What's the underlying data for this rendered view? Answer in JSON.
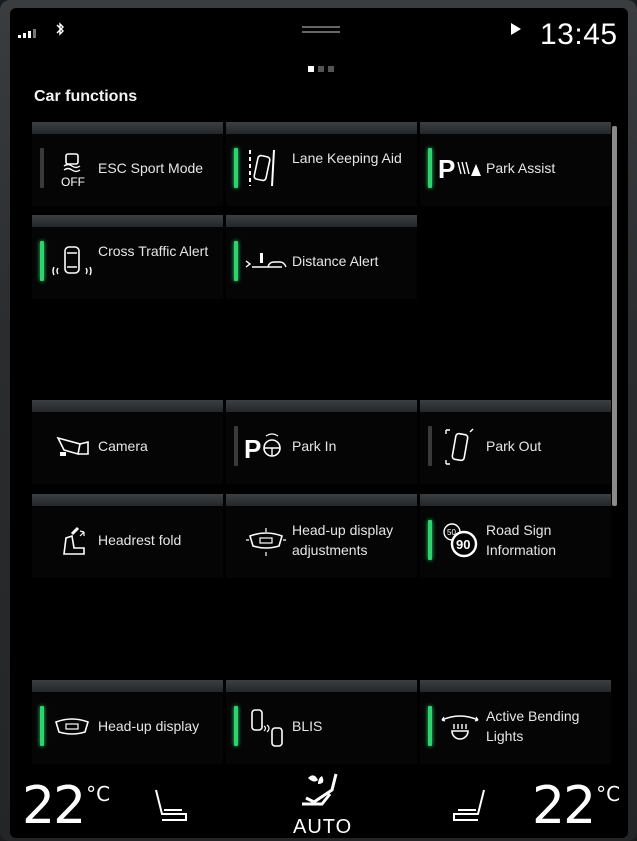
{
  "status": {
    "time": "13:45",
    "signal_icon": "signal-icon",
    "bluetooth_icon": "bluetooth-icon",
    "navigation_icon": "navigation-arrow-icon"
  },
  "section_title": "Car functions",
  "accent_color": "#2fd36e",
  "tiles": [
    {
      "label": "ESC Sport Mode",
      "icon": "esc-off-icon",
      "active": false
    },
    {
      "label": "Lane Keeping Aid",
      "icon": "lane-keeping-icon",
      "active": true
    },
    {
      "label": "Park Assist",
      "icon": "park-assist-icon",
      "active": true
    },
    {
      "label": "Cross Traffic Alert",
      "icon": "cross-traffic-icon",
      "active": true
    },
    {
      "label": "Distance Alert",
      "icon": "distance-alert-icon",
      "active": true
    },
    {
      "label": "Camera",
      "icon": "camera-icon",
      "active": null
    },
    {
      "label": "Park In",
      "icon": "park-in-icon",
      "active": false
    },
    {
      "label": "Park Out",
      "icon": "park-out-icon",
      "active": false
    },
    {
      "label": "Headrest fold",
      "icon": "headrest-fold-icon",
      "active": null
    },
    {
      "label": "Head-up display adjustments",
      "icon": "hud-adjust-icon",
      "active": null
    },
    {
      "label": "Road Sign Information",
      "icon": "road-sign-icon",
      "active": true
    },
    {
      "label": "Head-up display",
      "icon": "hud-icon",
      "active": true
    },
    {
      "label": "BLIS",
      "icon": "blis-icon",
      "active": true
    },
    {
      "label": "Active Bending Lights",
      "icon": "bending-lights-icon",
      "active": true
    }
  ],
  "climate": {
    "left_temp": "22",
    "right_temp": "22",
    "unit": "°C",
    "mode": "AUTO",
    "fan_icon": "fan-icon"
  }
}
